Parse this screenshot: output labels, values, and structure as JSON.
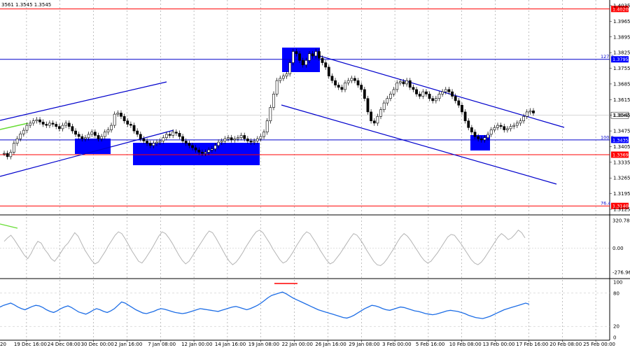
{
  "chart_data": {
    "type": "candlestick",
    "instrument_info": "3561 1.3545 1.3545",
    "colors": {
      "background": "#ffffff",
      "grid": "#808080",
      "candle": "#000000",
      "channel": "#0000cc",
      "zone": "#0000ff",
      "red_level": "#ff0000",
      "red_label_bg": "#ff0000",
      "blue_label_bg": "#0000ff",
      "cci_line": "#b4b4b4",
      "rsi_line": "#1e6ee6",
      "green": "#66dd33"
    },
    "x_axis": {
      "labels": [
        "19 Dec 16:00",
        "24 Dec 08:00",
        "30 Dec 00:00",
        "2 Jan 16:00",
        "7 Jan 08:00",
        "12 Jan 00:00",
        "14 Jan 16:00",
        "19 Jan 08:00",
        "22 Jan 00:00",
        "26 Jan 16:00",
        "29 Jan 08:00",
        "3 Feb 00:00",
        "5 Feb 16:00",
        "10 Feb 08:00",
        "13 Feb 00:00",
        "17 Feb 16:00",
        "20 Feb 08:00",
        "25 Feb 00:00"
      ],
      "first_label": "20"
    },
    "price_axis": {
      "ylim": [
        1.3125,
        1.4035
      ],
      "ticks": [
        "1.4035",
        "1.3965",
        "1.3895",
        "1.3825",
        "1.3755",
        "1.3685",
        "1.3615",
        "1.3545",
        "1.3475",
        "1.3405",
        "1.3335",
        "1.3265",
        "1.3195",
        "1.3125"
      ],
      "tick_values": [
        1.4035,
        1.3965,
        1.3895,
        1.3825,
        1.3755,
        1.3685,
        1.3615,
        1.3545,
        1.3475,
        1.3405,
        1.3335,
        1.3265,
        1.3195,
        1.3125
      ]
    },
    "horizontal_levels": [
      {
        "value": 1.402,
        "label": "1.4020",
        "color": "red"
      },
      {
        "value": 1.3795,
        "label": "1.3795",
        "color": "blue",
        "fib_label": "127.2"
      },
      {
        "value": 1.3545,
        "label": "1.3545",
        "color": "grey"
      },
      {
        "value": 1.3435,
        "label": "1.3435",
        "color": "blue",
        "fib_label": "100.0"
      },
      {
        "value": 1.3369,
        "label": "1.3369",
        "color": "red"
      },
      {
        "value": 1.314,
        "label": "1.3140",
        "color": "red",
        "fib_label": "76.4"
      }
    ],
    "series": [
      {
        "name": "price",
        "values": [
          1.3375,
          1.336,
          1.338,
          1.342,
          1.344,
          1.3462,
          1.3478,
          1.35,
          1.351,
          1.352,
          1.3525,
          1.3515,
          1.3505,
          1.35,
          1.351,
          1.3505,
          1.3495,
          1.3485,
          1.35,
          1.351,
          1.3495,
          1.3475,
          1.346,
          1.345,
          1.344,
          1.3445,
          1.346,
          1.347,
          1.3455,
          1.344,
          1.345,
          1.347,
          1.348,
          1.35,
          1.355,
          1.3555,
          1.354,
          1.352,
          1.3505,
          1.35,
          1.3475,
          1.346,
          1.344,
          1.343,
          1.342,
          1.341,
          1.342,
          1.3425,
          1.343,
          1.3445,
          1.346,
          1.3455,
          1.347,
          1.3465,
          1.345,
          1.343,
          1.342,
          1.341,
          1.34,
          1.339,
          1.338,
          1.3375,
          1.338,
          1.339,
          1.3395,
          1.341,
          1.3425,
          1.343,
          1.344,
          1.3445,
          1.3435,
          1.344,
          1.3445,
          1.3455,
          1.344,
          1.343,
          1.3425,
          1.343,
          1.344,
          1.345,
          1.347,
          1.352,
          1.358,
          1.364,
          1.37,
          1.371,
          1.372,
          1.373,
          1.378,
          1.383,
          1.382,
          1.379,
          1.377,
          1.379,
          1.382,
          1.381,
          1.383,
          1.38,
          1.378,
          1.376,
          1.372,
          1.37,
          1.368,
          1.367,
          1.366,
          1.369,
          1.37,
          1.371,
          1.37,
          1.368,
          1.366,
          1.362,
          1.356,
          1.352,
          1.351,
          1.354,
          1.357,
          1.36,
          1.362,
          1.364,
          1.366,
          1.369,
          1.3695,
          1.3685,
          1.37,
          1.367,
          1.366,
          1.364,
          1.363,
          1.365,
          1.364,
          1.362,
          1.361,
          1.362,
          1.364,
          1.365,
          1.366,
          1.365,
          1.363,
          1.361,
          1.359,
          1.356,
          1.352,
          1.349,
          1.347,
          1.345,
          1.344,
          1.3435,
          1.3445,
          1.346,
          1.348,
          1.349,
          1.35,
          1.3495,
          1.348,
          1.3485,
          1.3495,
          1.35,
          1.351,
          1.352,
          1.354,
          1.356,
          1.3565,
          1.3555
        ]
      },
      {
        "name": "cci",
        "values": [
          80,
          120,
          150,
          100,
          40,
          -20,
          -80,
          -120,
          -60,
          20,
          80,
          60,
          -10,
          -60,
          -120,
          -150,
          -100,
          -40,
          20,
          60,
          120,
          180,
          140,
          60,
          -20,
          -80,
          -140,
          -180,
          -160,
          -100,
          -40,
          30,
          90,
          150,
          190,
          170,
          110,
          40,
          -30,
          -90,
          -150,
          -170,
          -120,
          -60,
          0,
          70,
          140,
          190,
          170,
          120,
          60,
          -10,
          -80,
          -140,
          -180,
          -150,
          -90,
          -30,
          30,
          90,
          150,
          200,
          180,
          120,
          50,
          -20,
          -90,
          -150,
          -190,
          -160,
          -110,
          -50,
          20,
          80,
          140,
          190,
          210,
          180,
          120,
          60,
          -10,
          -70,
          -130,
          -170,
          -150,
          -100,
          -40,
          30,
          90,
          150,
          190,
          170,
          110,
          50,
          -20,
          -80,
          -140,
          -180,
          -160,
          -110,
          -60,
          0,
          60,
          120,
          170,
          150,
          100,
          40,
          -30,
          -90,
          -150,
          -190,
          -200,
          -170,
          -120,
          -60,
          0,
          70,
          130,
          170,
          140,
          90,
          30,
          -30,
          -90,
          -140,
          -170,
          -150,
          -100,
          -50,
          10,
          70,
          130,
          160,
          150,
          100,
          50,
          -10,
          -70,
          -130,
          -170,
          -190,
          -160,
          -110,
          -50,
          10,
          70,
          130,
          170,
          140,
          100,
          120,
          160,
          210,
          180,
          120
        ]
      },
      {
        "name": "rsi",
        "values": [
          55,
          58,
          60,
          62,
          59,
          55,
          52,
          50,
          53,
          56,
          58,
          57,
          54,
          50,
          47,
          45,
          48,
          52,
          55,
          57,
          54,
          50,
          46,
          44,
          42,
          45,
          49,
          52,
          50,
          47,
          45,
          48,
          52,
          58,
          64,
          62,
          58,
          54,
          50,
          47,
          44,
          43,
          45,
          47,
          50,
          52,
          51,
          49,
          47,
          45,
          44,
          43,
          44,
          46,
          48,
          50,
          52,
          51,
          50,
          49,
          48,
          47,
          49,
          51,
          53,
          55,
          56,
          54,
          52,
          50,
          52,
          55,
          58,
          62,
          67,
          72,
          76,
          78,
          80,
          82,
          79,
          75,
          71,
          68,
          65,
          62,
          59,
          56,
          53,
          50,
          48,
          46,
          44,
          42,
          40,
          38,
          36,
          35,
          37,
          40,
          44,
          48,
          52,
          55,
          58,
          57,
          55,
          52,
          50,
          49,
          51,
          53,
          55,
          54,
          52,
          50,
          48,
          47,
          45,
          43,
          42,
          41,
          42,
          44,
          46,
          48,
          49,
          48,
          47,
          45,
          43,
          40,
          38,
          36,
          35,
          34,
          36,
          38,
          41,
          44,
          47,
          50,
          52,
          54,
          56,
          58,
          60,
          62,
          60
        ]
      }
    ],
    "cci_axis": {
      "ticks": [
        "320.7896",
        "0.00",
        "-276.960"
      ],
      "tick_values": [
        320.7896,
        0,
        -276.96
      ]
    },
    "rsi_axis": {
      "ticks": [
        "100",
        "80",
        "20",
        "0"
      ],
      "tick_values": [
        100,
        80,
        20,
        0
      ]
    }
  }
}
